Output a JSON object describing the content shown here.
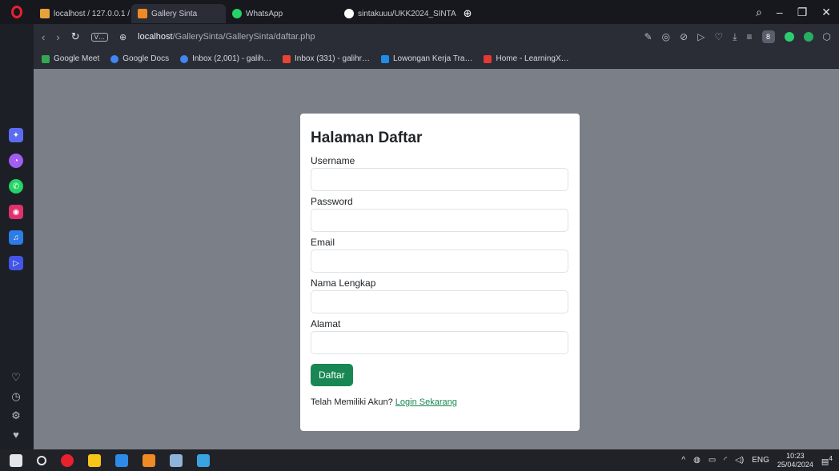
{
  "tabs": [
    {
      "label": "localhost / 127.0.0.1 / ukk…",
      "color": "#e9a23b"
    },
    {
      "label": "Gallery Sinta",
      "color": "#f08a24",
      "active": true
    },
    {
      "label": "WhatsApp",
      "color": "#25d366"
    },
    {
      "label": "sintakuuu/UKK2024_SINTA",
      "color": "#ffffff"
    }
  ],
  "address": {
    "vpn": "V…",
    "host": "localhost",
    "path": "/GallerySinta/GallerySinta/daftar.php",
    "profile": "8"
  },
  "bookmarks": [
    {
      "label": "Google Meet",
      "color": "#34a853"
    },
    {
      "label": "Google Docs",
      "color": "#4285f4"
    },
    {
      "label": "Inbox (2,001) - galih…",
      "color": "#4285f4"
    },
    {
      "label": "Inbox (331) - galihr…",
      "color": "#ea4335"
    },
    {
      "label": "Lowongan Kerja Tra…",
      "color": "#1f8ceb"
    },
    {
      "label": "Home - LearningX…",
      "color": "#e53935"
    }
  ],
  "form": {
    "title": "Halaman Daftar",
    "username_label": "Username",
    "password_label": "Password",
    "email_label": "Email",
    "fullname_label": "Nama Lengkap",
    "address_label": "Alamat",
    "submit_label": "Daftar",
    "login_prompt": "Telah Memiliki Akun?",
    "login_link": "Login Sekarang"
  },
  "taskbar": {
    "language": "ENG",
    "time": "10:23",
    "date": "25/04/2024",
    "notification_count": "4"
  },
  "colors": {
    "accent": "#198754",
    "page_bg": "#7a7f88"
  }
}
